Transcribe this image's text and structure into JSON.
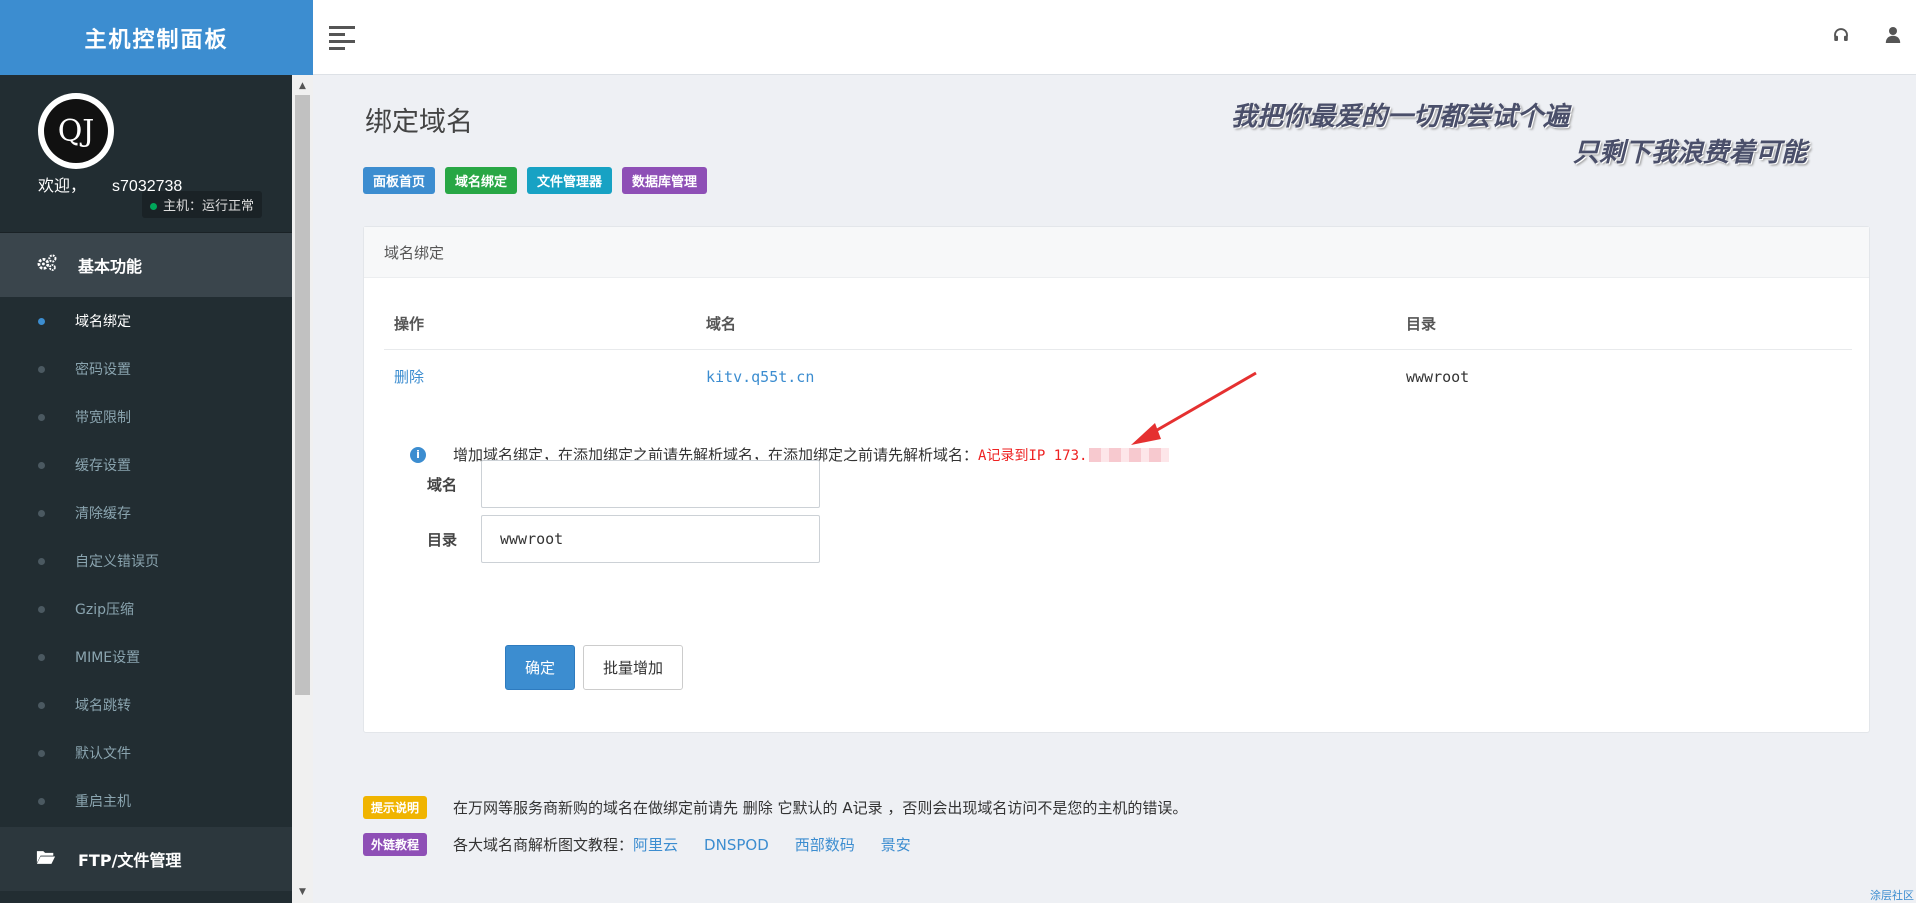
{
  "brand": {
    "title": "主机控制面板"
  },
  "profile": {
    "avatar_text": "QJ",
    "welcome_label": "欢迎，",
    "username": "s7032738",
    "host_status": "主机：运行正常"
  },
  "sidebar": {
    "section_basic": "基本功能",
    "items": [
      {
        "label": "域名绑定",
        "active": true
      },
      {
        "label": "密码设置"
      },
      {
        "label": "带宽限制"
      },
      {
        "label": "缓存设置"
      },
      {
        "label": "清除缓存"
      },
      {
        "label": "自定义错误页"
      },
      {
        "label": "Gzip压缩"
      },
      {
        "label": "MIME设置"
      },
      {
        "label": "域名跳转"
      },
      {
        "label": "默认文件"
      },
      {
        "label": "重启主机"
      }
    ],
    "section_ftp": "FTP/文件管理"
  },
  "page": {
    "title": "绑定域名",
    "slogan_line1": "我把你最爱的一切都尝试个遍",
    "slogan_line2": "只剩下我浪费着可能",
    "tags": [
      {
        "label": "面板首页",
        "color": "#3c8dd0"
      },
      {
        "label": "域名绑定",
        "color": "#28a745"
      },
      {
        "label": "文件管理器",
        "color": "#17a2c4"
      },
      {
        "label": "数据库管理",
        "color": "#8e4fb6"
      }
    ]
  },
  "card": {
    "heading": "域名绑定",
    "table": {
      "headers": [
        "操作",
        "域名",
        "目录"
      ],
      "rows": [
        {
          "action": "删除",
          "domain": "kitv.q55t.cn",
          "dir": "wwwroot"
        }
      ]
    },
    "notice": {
      "text": "增加域名绑定，在添加绑定之前请先解析域名，在添加绑定之前请先解析域名：",
      "red": "A记录到IP 173."
    },
    "form": {
      "domain_label": "域名",
      "domain_value": "",
      "dir_label": "目录",
      "dir_value": "wwwroot",
      "confirm_label": "确定",
      "batch_label": "批量增加"
    }
  },
  "footer": {
    "tip_badge": "提示说明",
    "tip_text": "在万网等服务商新购的域名在做绑定前请先 删除 它默认的 A记录 ，否则会出现域名访问不是您的主机的错误。",
    "link_badge": "外链教程",
    "link_text": "各大域名商解析图文教程：",
    "links": [
      "阿里云",
      "DNSPOD",
      "西部数码",
      "景安"
    ],
    "corner": "涂层社区"
  },
  "colors": {
    "accent": "#3c8dd0",
    "sidebar_bg": "#222d32",
    "tip_badge": "#f0b400",
    "link_badge": "#8e4fb6"
  }
}
